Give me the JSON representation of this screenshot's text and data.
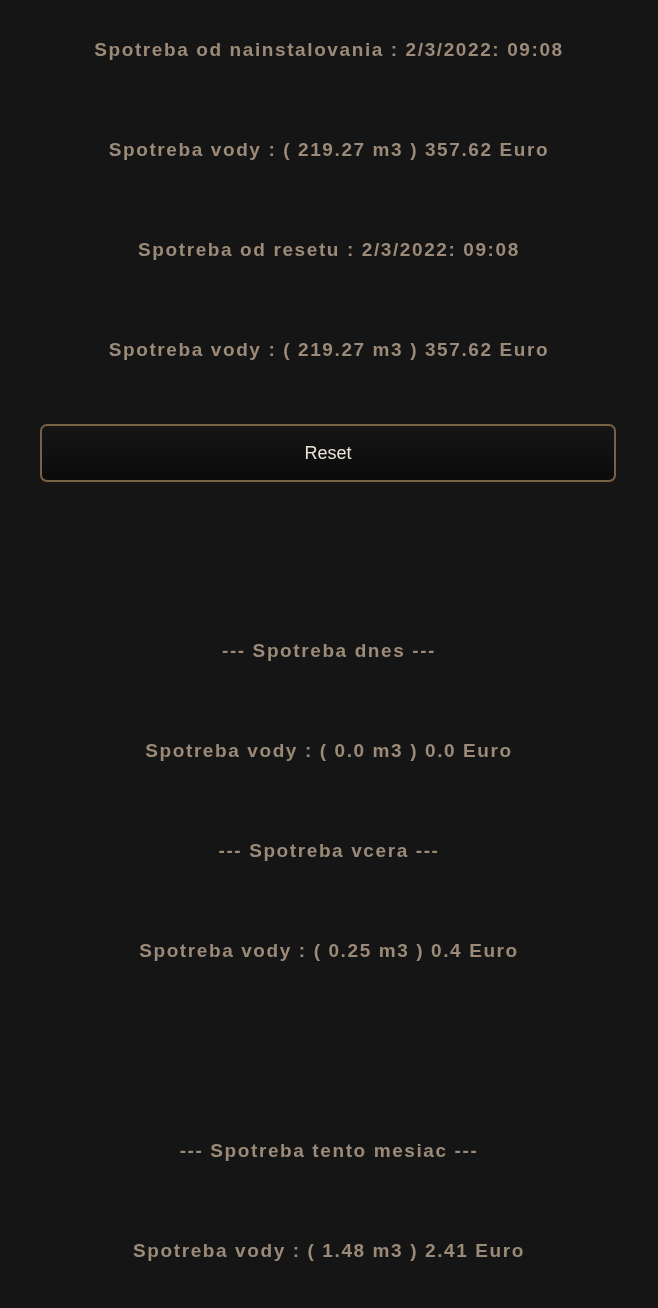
{
  "since_install": {
    "label": "Spotreba od nainstalovania : 2/3/2022: 09:08",
    "value": "Spotreba vody : ( 219.27 m3 ) 357.62 Euro"
  },
  "since_reset": {
    "label": "Spotreba od resetu : 2/3/2022: 09:08",
    "value": "Spotreba vody : ( 219.27 m3 ) 357.62 Euro"
  },
  "reset_button": {
    "label": "Reset"
  },
  "today": {
    "heading": "--- Spotreba dnes ---",
    "value": "Spotreba vody : ( 0.0 m3 ) 0.0 Euro"
  },
  "yesterday": {
    "heading": "--- Spotreba vcera ---",
    "value": "Spotreba vody : ( 0.25 m3 ) 0.4 Euro"
  },
  "this_month": {
    "heading": "--- Spotreba tento mesiac ---",
    "value": "Spotreba vody : ( 1.48 m3 ) 2.41 Euro"
  }
}
